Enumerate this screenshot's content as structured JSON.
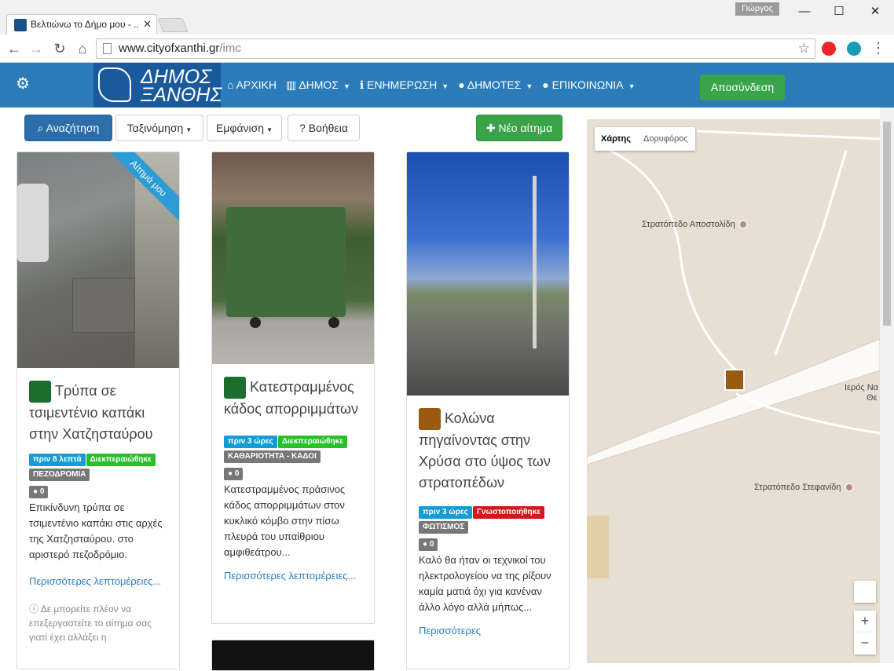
{
  "browser": {
    "tab_title": "Βελτιώνω το Δήμο μου - ...",
    "profile_name": "Γιώργος",
    "url_host": "www.cityofxanthi.gr",
    "url_path": "/imc"
  },
  "header": {
    "logo_line1": "ΔΗΜΟΣ",
    "logo_line2": "ΞΑΝΘΗΣ",
    "nav": [
      {
        "label": "ΑΡΧΙΚΗ",
        "icon": "home-icon"
      },
      {
        "label": "ΔΗΜΟΣ",
        "icon": "bank-icon"
      },
      {
        "label": "ΕΝΗΜΕΡΩΣΗ",
        "icon": "info-icon"
      },
      {
        "label": "ΔΗΜΟΤΕΣ",
        "icon": "user-icon"
      },
      {
        "label": "ΕΠΙΚΟΙΝΩΝΙΑ",
        "icon": "comment-icon"
      }
    ],
    "logout_label": "Αποσύνδεση"
  },
  "actions": {
    "search": "Αναζήτηση",
    "sort": "Ταξινόμηση",
    "view": "Εμφάνιση",
    "help": "Βοήθεια",
    "new_issue": "Νέο αίτημα"
  },
  "cards": [
    {
      "ribbon": "Αίτημά μου",
      "title": "Τρύπα σε τσιμεντένιο καπάκι στην Χατζησταύρου",
      "time": "πριν 8 λεπτά",
      "status": "Διεκπεραιώθηκε",
      "category": "ΠΕΖΟΔΡΟΜΙΑ",
      "comments": "0",
      "description": "Επικίνδυνη τρύπα σε τσιμεντένιο καπάκι στις αρχές της Χατζησταύρου. στο αριστερό πεζοδρόμιο.",
      "more": "Περισσότερες λεπτομέρειες...",
      "note": "Δε μπορείτε πλέον να επεξεργαστείτε το αίτημα σας γιατί έχει αλλάξει η"
    },
    {
      "title": "Κατεστραμμένος κάδος απορριμμάτων",
      "time": "πριν 3 ώρες",
      "status": "Διεκπεραιώθηκε",
      "category": "ΚΑΘΑΡΙΟΤΗΤΑ - ΚΑΔΟΙ",
      "comments": "0",
      "description": "Κατεστραμμένος πράσινος κάδος απορριμμάτων στον κυκλικό κόμβο στην πίσω πλευρά του υπαίθριου αμφιθεάτρου...",
      "more": "Περισσότερες λεπτομέρειες..."
    },
    {
      "title": "Κολώνα πηγαίνοντας στην Χρύσα στο ύψος των στρατοπέδων",
      "time": "πριν 3 ώρες",
      "status": "Γνωστοποιήθηκε",
      "category": "ΦΩΤΙΣΜΟΣ",
      "comments": "0",
      "description": "Καλό θα ήταν οι τεχνικοί του ηλεκτρολογείου να της ρίξουν καμία ματιά όχι για κανέναν άλλο λόγο αλλά μήπως...",
      "more": "Περισσότερες"
    }
  ],
  "map": {
    "type_map": "Χάρτης",
    "type_satellite": "Δορυφόρος",
    "places": [
      "Στρατόπεδο Αποστολίδη",
      "Ιερός Να",
      "Θε",
      "Στρατόπεδο Στεφανίδη"
    ],
    "zoom_in": "+",
    "zoom_out": "−"
  },
  "colors": {
    "header_bg": "#2b7cb9",
    "primary": "#2b6eaa",
    "success": "#3aa348",
    "label_time": "#149cd4",
    "label_closed": "#27c02a",
    "label_ack": "#d6161a",
    "label_category": "#777777"
  }
}
